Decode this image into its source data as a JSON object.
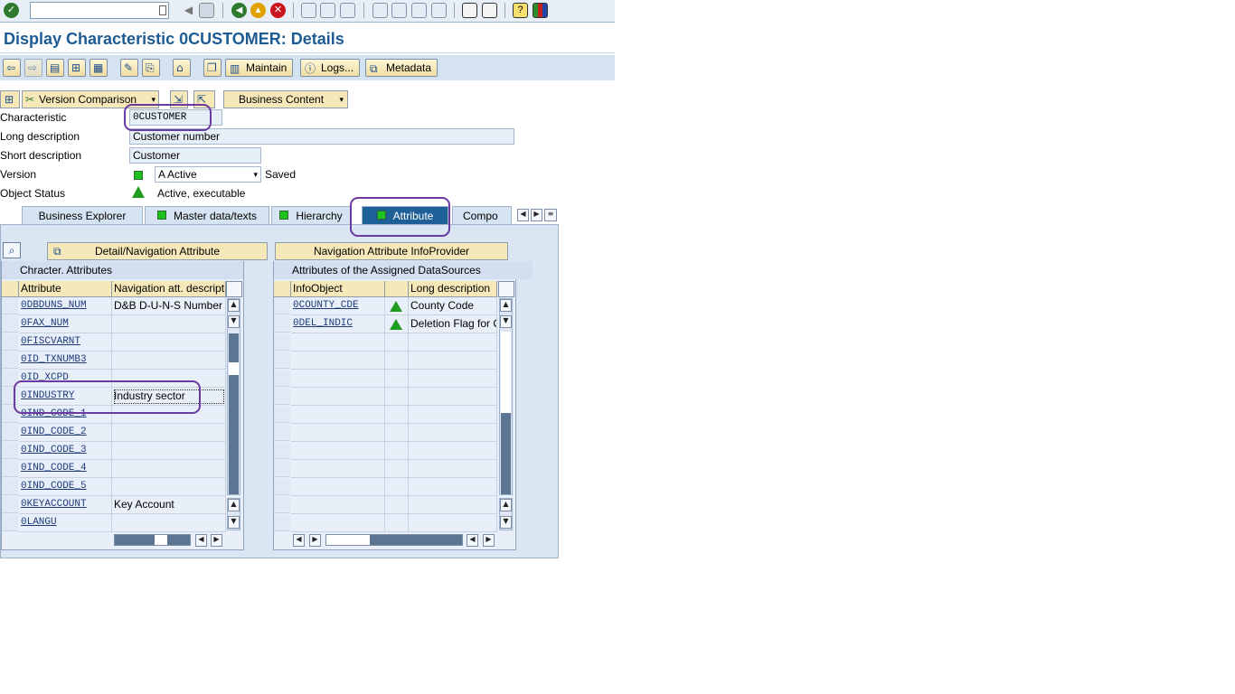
{
  "window": {
    "title": "Display Characteristic 0CUSTOMER: Details"
  },
  "toolbar": {
    "command_field_value": "",
    "icons": [
      "enter-icon",
      "back-icon",
      "save-icon",
      "back-nav-icon",
      "exit-icon",
      "cancel-icon",
      "print-icon",
      "find-icon",
      "find-next-icon",
      "first-page-icon",
      "prev-page-icon",
      "next-page-icon",
      "last-page-icon",
      "new-session-icon",
      "shortcut-icon",
      "help-icon",
      "layout-icon"
    ]
  },
  "app_toolbar": {
    "maintain": "Maintain",
    "logs": "Logs...",
    "metadata": "Metadata"
  },
  "secondary_toolbar": {
    "version_comparison": "Version Comparison",
    "business_content": "Business Content"
  },
  "header": {
    "characteristic_label": "Characteristic",
    "characteristic_value": "0CUSTOMER",
    "long_desc_label": "Long description",
    "long_desc_value": "Customer number",
    "short_desc_label": "Short description",
    "short_desc_value": "Customer",
    "version_label": "Version",
    "version_value": "A Active",
    "version_status": "Saved",
    "object_status_label": "Object Status",
    "object_status_value": "Active, executable"
  },
  "tabs": [
    {
      "label": "Business Explorer"
    },
    {
      "label": "Master data/texts"
    },
    {
      "label": "Hierarchy"
    },
    {
      "label": "Attribute"
    },
    {
      "label": "Compo"
    }
  ],
  "buttons": {
    "detail_nav": "Detail/Navigation Attribute",
    "nav_infoprovider": "Navigation Attribute InfoProvider"
  },
  "left_grid": {
    "title": "Chracter. Attributes",
    "col_attribute": "Attribute",
    "col_nav": "Navigation att. descripti",
    "rows": [
      {
        "attr": "0DBDUNS_NUM",
        "desc": "D&B D-U-N-S Number"
      },
      {
        "attr": "0FAX_NUM",
        "desc": ""
      },
      {
        "attr": "0FISCVARNT",
        "desc": ""
      },
      {
        "attr": "0ID_TXNUMB3",
        "desc": ""
      },
      {
        "attr": "0ID_XCPD",
        "desc": ""
      },
      {
        "attr": "0INDUSTRY",
        "desc": "Industry sector"
      },
      {
        "attr": "0IND_CODE_1",
        "desc": ""
      },
      {
        "attr": "0IND_CODE_2",
        "desc": ""
      },
      {
        "attr": "0IND_CODE_3",
        "desc": ""
      },
      {
        "attr": "0IND_CODE_4",
        "desc": ""
      },
      {
        "attr": "0IND_CODE_5",
        "desc": ""
      },
      {
        "attr": "0KEYACCOUNT",
        "desc": "Key Account"
      },
      {
        "attr": "0LANGU",
        "desc": ""
      }
    ]
  },
  "right_grid": {
    "title": "Attributes of the Assigned DataSources",
    "col_infoobject": "InfoObject",
    "col_longdesc": "Long description",
    "rows": [
      {
        "obj": "0COUNTY_CDE",
        "desc": "County Code"
      },
      {
        "obj": "0DEL_INDIC",
        "desc": "Deletion Flag for C"
      }
    ]
  }
}
